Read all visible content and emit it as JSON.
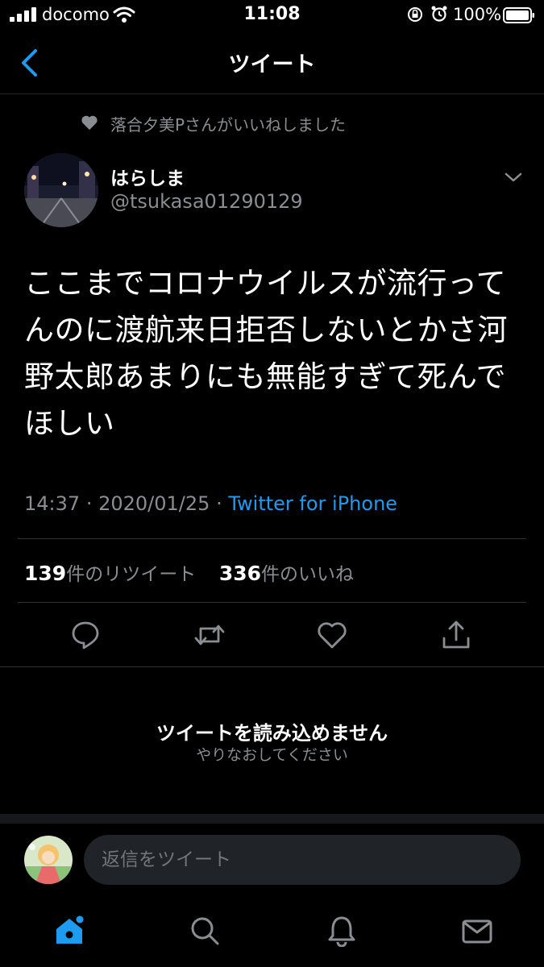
{
  "status_bar": {
    "carrier": "docomo",
    "time": "11:08",
    "battery": "100%"
  },
  "nav": {
    "title": "ツイート"
  },
  "tweet": {
    "liked_by": "落合夕美Pさんがいいねしました",
    "display_name": "はらしま",
    "handle": "@tsukasa01290129",
    "text": "ここまでコロナウイルスが流行ってんのに渡航来日拒否しないとかさ河野太郎あまりにも無能すぎて死んでほしい",
    "time": "14:37",
    "separator": "·",
    "date": "2020/01/25",
    "client": "Twitter for iPhone",
    "retweet_count": "139",
    "retweet_label": "件のリツイート",
    "like_count": "336",
    "like_label": "件のいいね"
  },
  "error": {
    "title": "ツイートを読み込めません",
    "subtitle": "やりなおしてください"
  },
  "reply": {
    "placeholder": "返信をツイート"
  },
  "tab_bar": {
    "items": [
      "home-icon",
      "search-icon",
      "notifications-icon",
      "messages-icon"
    ],
    "active": "home-icon"
  },
  "colors": {
    "accent": "#1d9bf0",
    "secondary_text": "#8a8d91",
    "background": "#000000"
  }
}
